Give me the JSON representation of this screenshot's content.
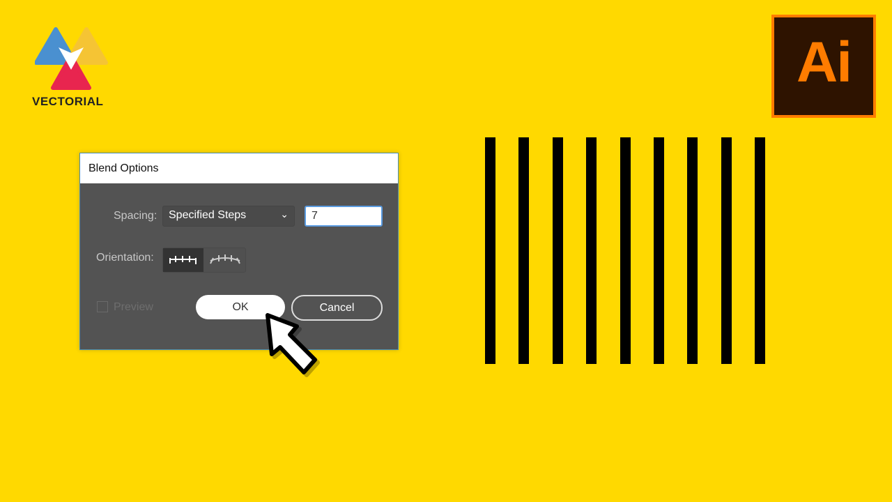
{
  "brand": {
    "logo_text": "VECTORIAL",
    "app_logo_text": "Ai",
    "background": "#FFD900",
    "accent": "#FF7C00"
  },
  "dialog": {
    "title": "Blend Options",
    "spacing_label": "Spacing:",
    "spacing_value": "Specified Steps",
    "steps_value": "7",
    "orientation_label": "Orientation:",
    "orientation_selected": "align-to-page",
    "preview_label": "Preview",
    "preview_checked": false,
    "ok_label": "OK",
    "cancel_label": "Cancel"
  },
  "artwork": {
    "bar_count": 9
  }
}
